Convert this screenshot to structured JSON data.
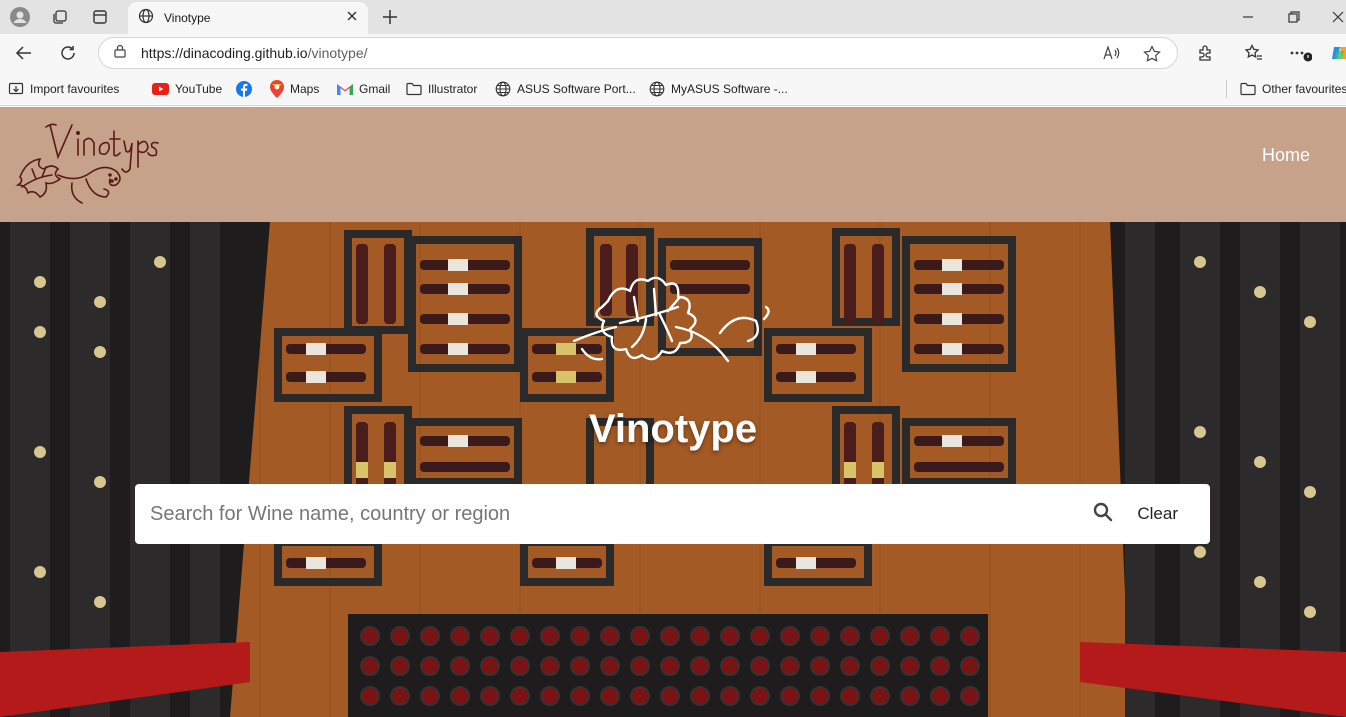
{
  "browser": {
    "tab_title": "Vinotype",
    "url_domain": "https://dinacoding.github.io",
    "url_path": "/vinotype/",
    "bookmarks": [
      {
        "label": "Import favourites",
        "icon": "import-icon"
      },
      {
        "label": "YouTube",
        "icon": "youtube-icon"
      },
      {
        "label": "",
        "icon": "facebook-icon"
      },
      {
        "label": "Maps",
        "icon": "maps-icon"
      },
      {
        "label": "Gmail",
        "icon": "gmail-icon"
      },
      {
        "label": "Illustrator",
        "icon": "folder-icon"
      },
      {
        "label": "ASUS Software Port...",
        "icon": "globe-icon"
      },
      {
        "label": "MyASUS Software -...",
        "icon": "globe-icon"
      }
    ],
    "other_favourites": "Other favourites"
  },
  "site": {
    "nav_home": "Home",
    "hero_title": "Vinotype",
    "search_placeholder": "Search for Wine name, country or region",
    "clear_label": "Clear"
  },
  "colors": {
    "header_bg": "#c5a289",
    "logo_stroke": "#5a1a14"
  }
}
